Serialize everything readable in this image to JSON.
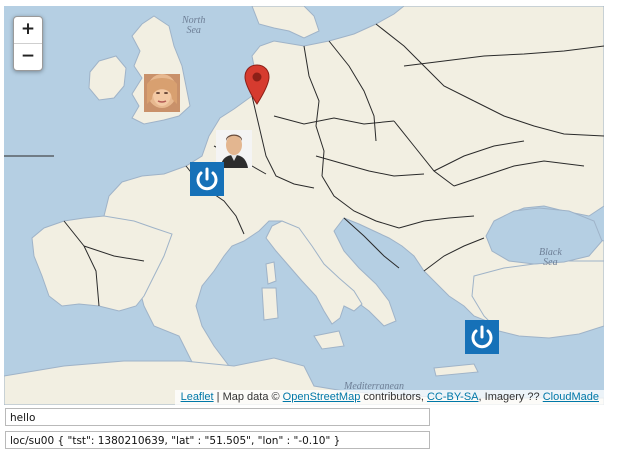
{
  "map": {
    "zoom_in_label": "+",
    "zoom_out_label": "−",
    "labels": {
      "north_sea": "North\nSea",
      "black_sea": "Black\nSea",
      "mediterranean": "Mediterranean"
    },
    "attribution": {
      "leaflet": "Leaflet",
      "sep1": " | Map data © ",
      "osm": "OpenStreetMap",
      "sep2": " contributors, ",
      "ccbysa": "CC-BY-SA",
      "sep3": ", Imagery ?? ",
      "cloudmade": "CloudMade"
    },
    "colors": {
      "sea": "#b5cfe3",
      "land": "#f2efe2",
      "border": "#2a2a2a",
      "pin": "#d63b2f",
      "power_icon_bg": "#1671b8"
    },
    "markers": [
      "red-pin-marker",
      "woman-avatar-marker",
      "man-avatar-marker",
      "power-icon-marker",
      "power-icon-marker"
    ]
  },
  "inputs": {
    "topic_value": "hello",
    "payload_value": "loc/su00 { \"tst\": 1380210639, \"lat\" : \"51.505\", \"lon\" : \"-0.10\" }"
  }
}
